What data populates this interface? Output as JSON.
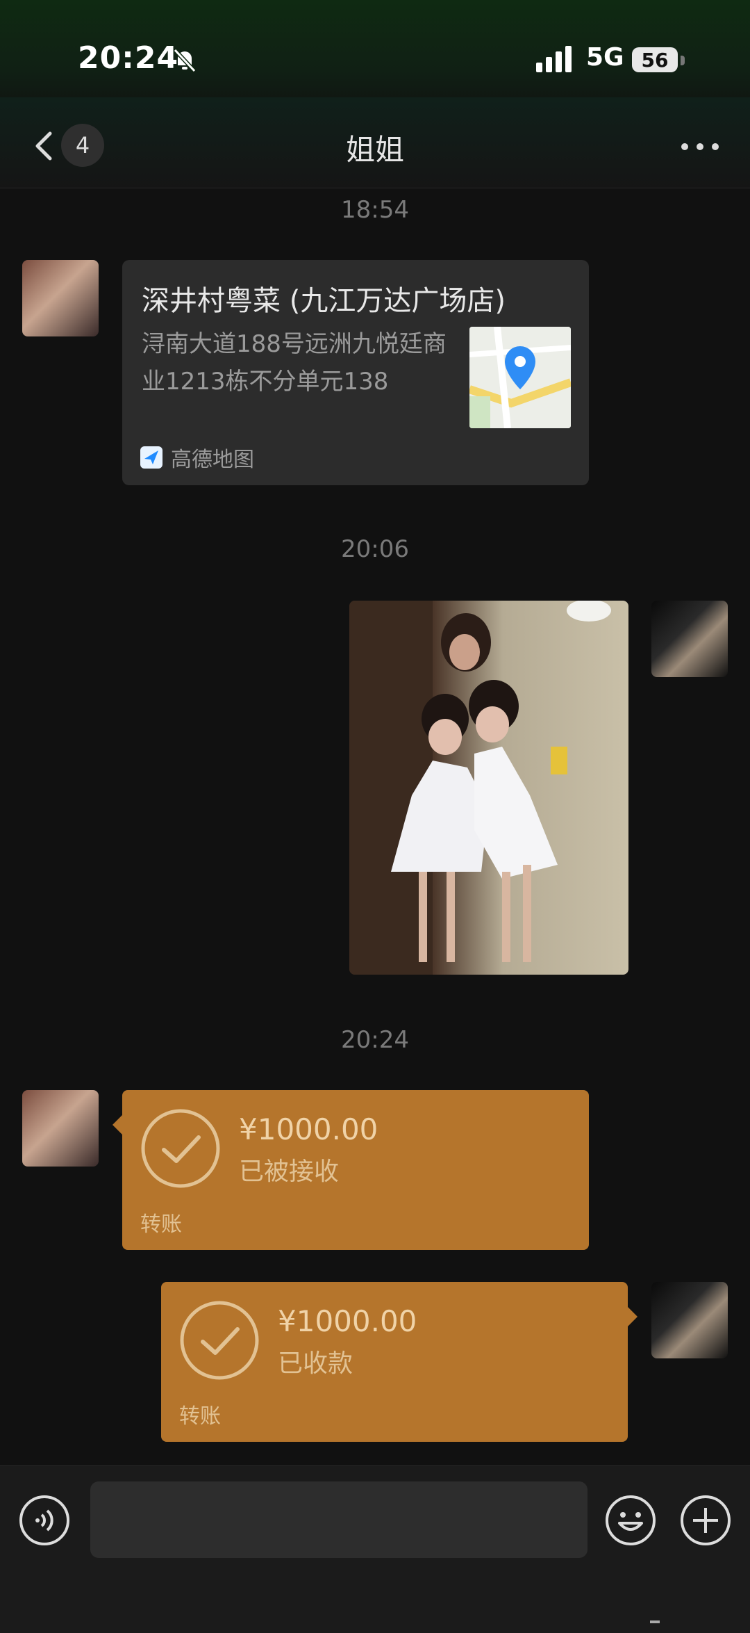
{
  "status_bar": {
    "time": "20:24",
    "network": "5G",
    "battery": "56"
  },
  "header": {
    "back_count": "4",
    "title": "姐姐"
  },
  "messages": {
    "ts1": "18:54",
    "location": {
      "name": "深井村粤菜 (九江万达广场店)",
      "address": "浔南大道188号远洲九悦廷商业1213栋不分单元138",
      "source": "高德地图"
    },
    "ts2": "20:06",
    "ts3": "20:24",
    "transfer_in": {
      "amount": "¥1000.00",
      "status": "已被接收",
      "label": "转账"
    },
    "transfer_out": {
      "amount": "¥1000.00",
      "status": "已收款",
      "label": "转账"
    }
  },
  "colors": {
    "transfer_bg": "#b5752c",
    "background": "#111111",
    "bubble": "#2c2c2c"
  }
}
